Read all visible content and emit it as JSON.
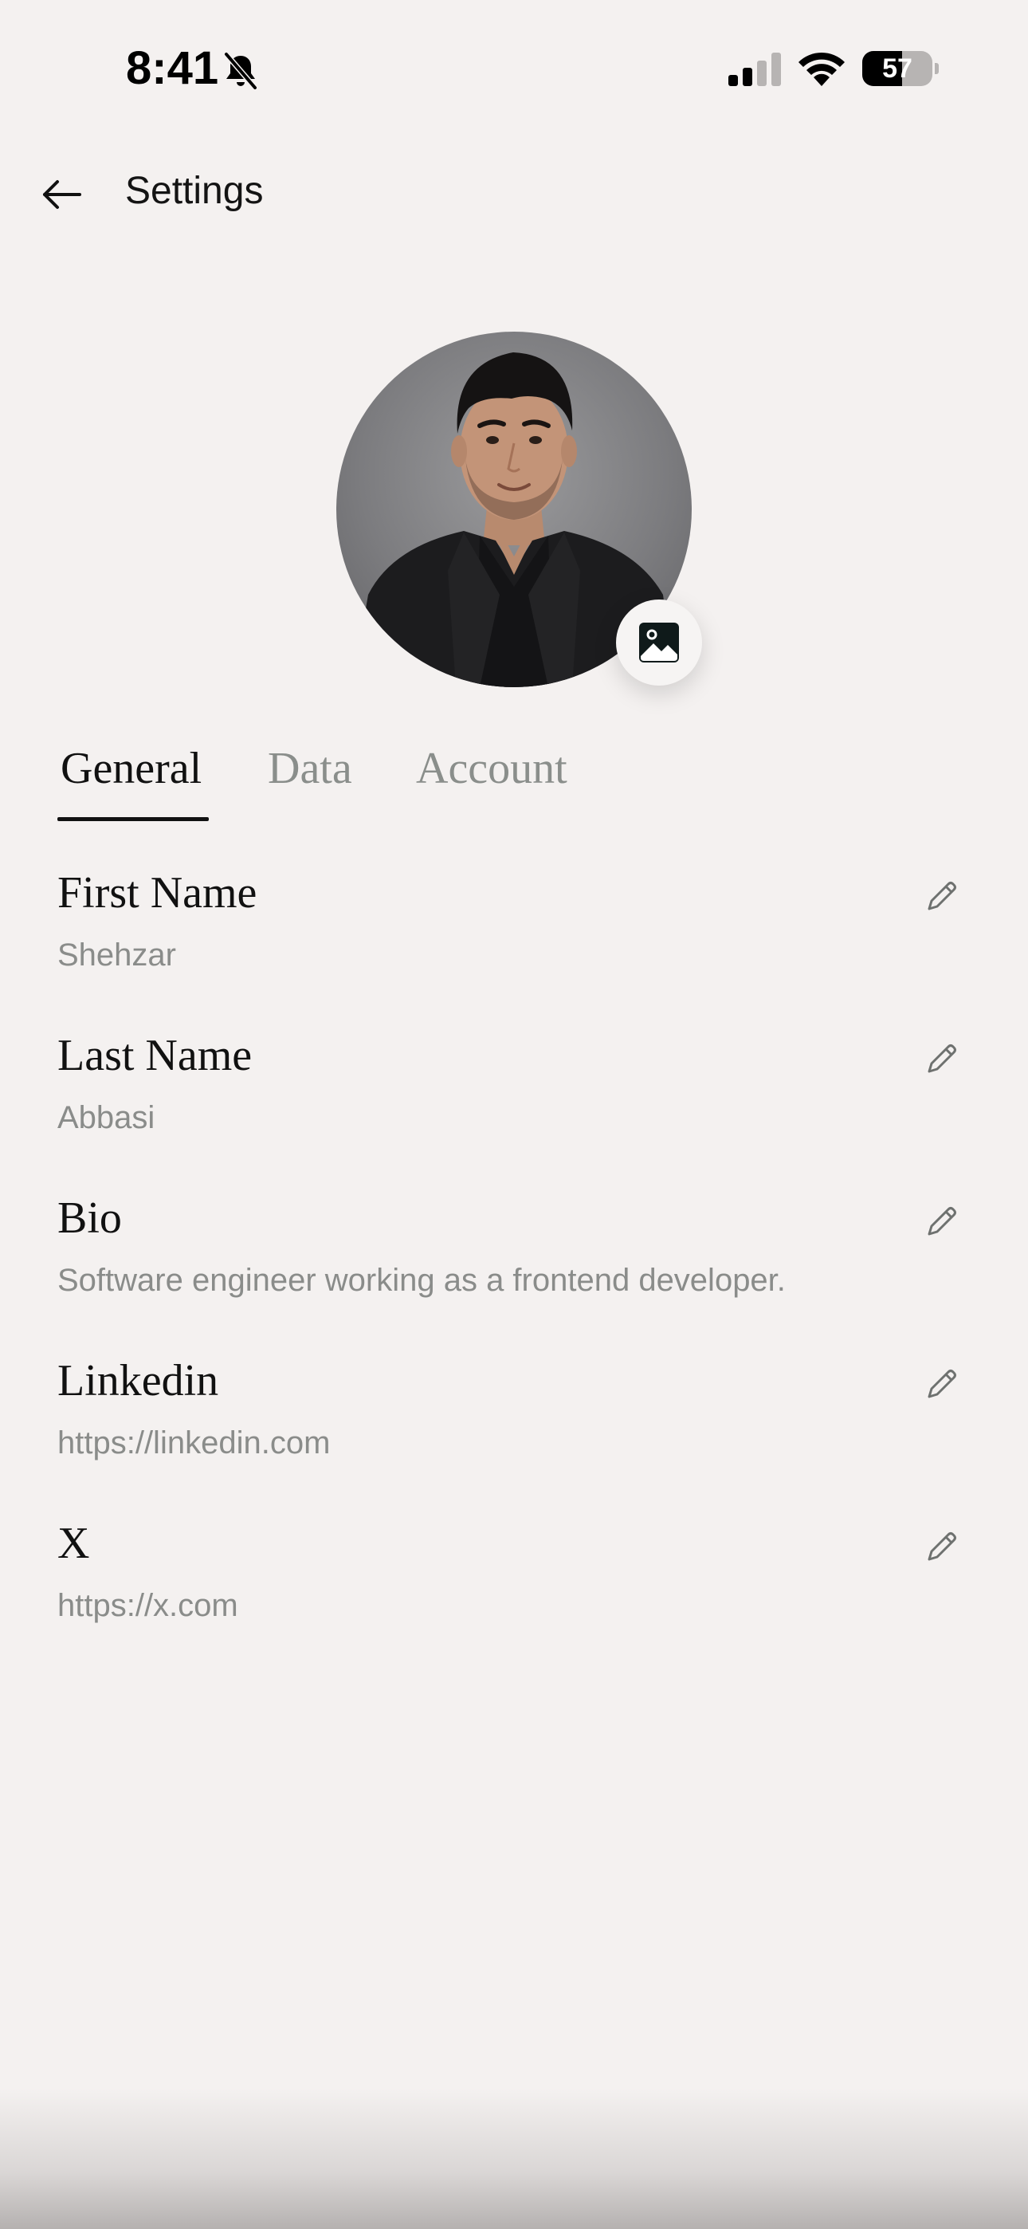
{
  "status_bar": {
    "time": "8:41",
    "battery_level": "57",
    "battery_fraction": 0.57,
    "icons": [
      "bell-slash-icon",
      "cellular-signal-icon",
      "wifi-icon",
      "battery-icon"
    ]
  },
  "header": {
    "back_icon": "arrow-left-icon",
    "title": "Settings"
  },
  "profile": {
    "avatar": "profile-photo",
    "photo_button_icon": "image-icon"
  },
  "tabs": [
    {
      "label": "General",
      "active": true
    },
    {
      "label": "Data",
      "active": false
    },
    {
      "label": "Account",
      "active": false
    }
  ],
  "fields": [
    {
      "label": "First Name",
      "value": "Shehzar"
    },
    {
      "label": "Last Name",
      "value": "Abbasi"
    },
    {
      "label": "Bio",
      "value": "Software engineer working as a frontend developer."
    },
    {
      "label": "Linkedin",
      "value": "https://linkedin.com"
    },
    {
      "label": "X",
      "value": "https://x.com"
    }
  ],
  "colors": {
    "background": "#f4f1f0",
    "text_primary": "#111111",
    "text_secondary": "#8a8c8a",
    "tab_inactive": "#8a8e8b"
  }
}
